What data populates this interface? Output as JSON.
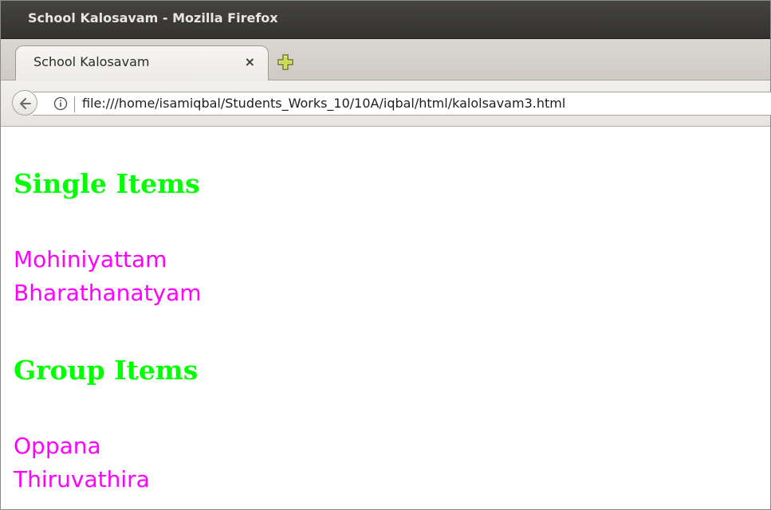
{
  "window": {
    "title": "School Kalosavam - Mozilla Firefox"
  },
  "tabs": [
    {
      "label": "School Kalosavam",
      "close_glyph": "×"
    }
  ],
  "navbar": {
    "url": "file:///home/isamiqbal/Students_Works_10/10A/iqbal/html/kalolsavam3.html"
  },
  "page": {
    "sections": [
      {
        "heading": "Single Items",
        "items": [
          "Mohiniyattam",
          "Bharathanatyam"
        ]
      },
      {
        "heading": "Group Items",
        "items": [
          "Oppana",
          "Thiruvathira"
        ]
      }
    ]
  },
  "icons": {
    "back": "back-arrow-icon",
    "info": "info-icon",
    "new_tab": "plus-icon"
  },
  "colors": {
    "heading": "#00ff00",
    "item": "#ff00ff"
  }
}
